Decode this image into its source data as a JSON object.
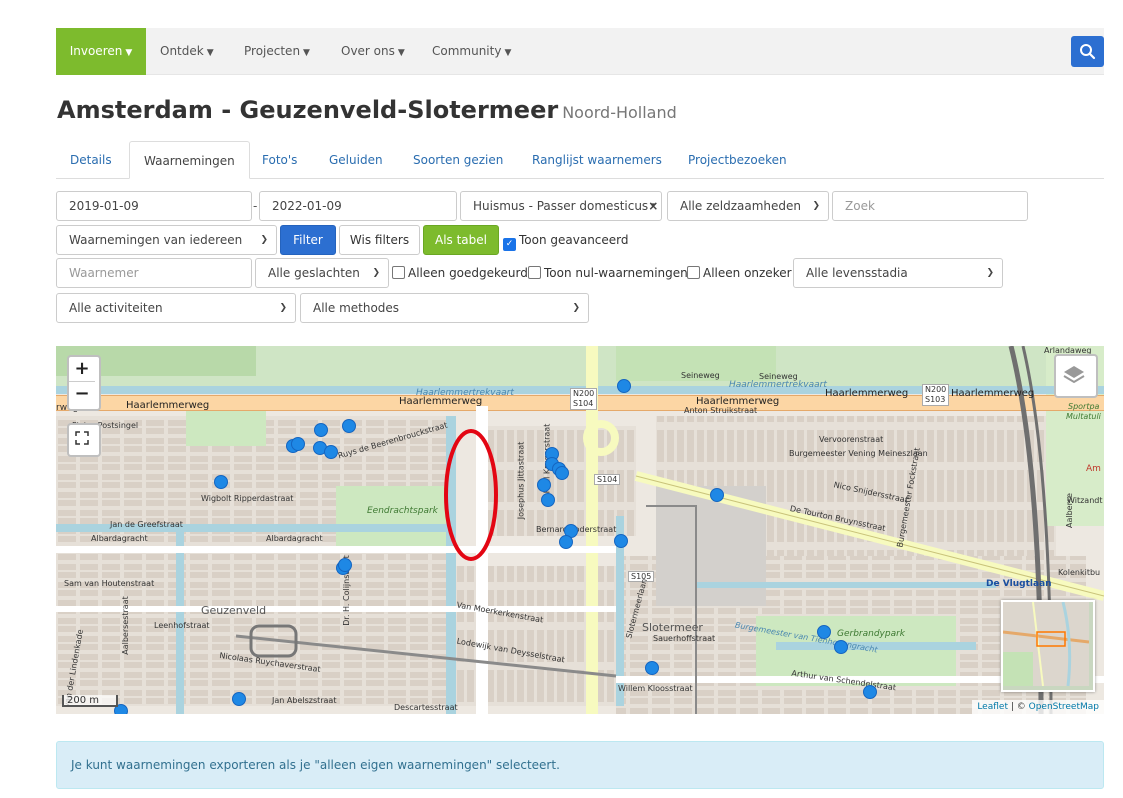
{
  "nav": {
    "items": [
      {
        "label": "Invoeren"
      },
      {
        "label": "Ontdek"
      },
      {
        "label": "Projecten"
      },
      {
        "label": "Over ons"
      },
      {
        "label": "Community"
      }
    ],
    "search_icon": "search-icon",
    "brand_color": "#7dbb2d",
    "accent_color": "#2c6fd1"
  },
  "title": {
    "main": "Amsterdam - Geuzenveld-Slotermeer",
    "province": "Noord-Holland"
  },
  "tabs": [
    {
      "label": "Details",
      "active": false
    },
    {
      "label": "Waarnemingen",
      "active": true
    },
    {
      "label": "Foto's",
      "active": false
    },
    {
      "label": "Geluiden",
      "active": false
    },
    {
      "label": "Soorten gezien",
      "active": false
    },
    {
      "label": "Ranglijst waarnemers",
      "active": false
    },
    {
      "label": "Projectbezoeken",
      "active": false
    }
  ],
  "filters": {
    "date_from": "2019-01-09",
    "date_separator": "-",
    "date_to": "2022-01-09",
    "species": "Huismus - Passer domesticus",
    "species_clear": "×",
    "rarity": "Alle zeldzaamheden",
    "search_placeholder": "Zoek",
    "observer_scope": "Waarnemingen van iedereen",
    "filter_button": "Filter",
    "clear_button": "Wis filters",
    "table_button": "Als tabel",
    "advanced_label": "Toon geavanceerd",
    "advanced_checked": true,
    "observer_placeholder": "Waarnemer",
    "sex": "Alle geslachten",
    "approved_label": "Alleen goedgekeurd",
    "zero_label": "Toon nul-waarnemingen",
    "uncertain_label": "Alleen onzeker",
    "life_stage": "Alle levensstadia",
    "activity": "Alle activiteiten",
    "method": "Alle methodes"
  },
  "map": {
    "zoom_in": "+",
    "zoom_out": "−",
    "scale_label": "200 m",
    "attribution_leaflet": "Leaflet",
    "attribution_sep": " | © ",
    "attribution_osm": "OpenStreetMap",
    "marker_color": "#1e88e5",
    "highlight_color": "#e30613",
    "street_labels": {
      "haarlemmerweg_west": "Haarlemmerweg",
      "haarlemmerweg_mid": "Haarlemmerweg",
      "haarlemmerweg_east": "Haarlemmerweg",
      "haarlemmerweg_east2": "Haarlemmerweg",
      "haarlemmerweg_far": "Haarlemmerweg",
      "haarlemmerweg_wrap": "rweg",
      "vaart1": "Haarlemmertrekvaart",
      "vaart2": "Haarlemmertrekvaart",
      "seineweg": "Seineweg",
      "arlandaweg": "Arlandaweg",
      "n200_a": "N200",
      "s104_a": "S104",
      "n200_b": "N200",
      "s103": "S103",
      "s104_b": "S104",
      "s105": "S105",
      "postsingel": "Pieter Postsingel",
      "ruys": "Ruys de Beerenbrouckstraat",
      "anton": "Anton Struikstraat",
      "vervoorenstraat": "Vervoorenstraat",
      "vening": "Burgemeester Vening Meineszlaan",
      "wigbolt": "Wigbolt Ripperdastraat",
      "greefstraat": "Jan de Greefstraat",
      "albardagracht1": "Albardagracht",
      "albardagracht2": "Albardagracht",
      "eendrachtspark": "Eendrachtspark",
      "bernard": "Bernard Loderstraat",
      "nico": "Nico Snijdersstraat",
      "tourton": "De Tourton Bruynsstraat",
      "vlugtlaan": "De Vlugtlaan",
      "kolenkit": "Kolenkitbu",
      "houtenstraat": "Sam van Houtenstraat",
      "moerkerken": "Van Moerkerkenstraat",
      "slotermeerlaan": "Slotermeerlaan",
      "slotermeer": "Slotermeer",
      "sauerhoff": "Sauerhoffstraat",
      "geuzenveld": "Geuzenveld",
      "leenhof": "Leenhofstraat",
      "deysselstraat": "Lodewijk van Deysselstraat",
      "nicolaas": "Nicolaas Ruychaverstraat",
      "abelszstraat": "Jan Abelszstraat",
      "descartes": "Descartesstraat",
      "kloosstraat": "Willem Kloosstraat",
      "schendel": "Arthur van Schendelstraat",
      "gerbrandypark": "Gerbrandypark",
      "tienhoven": "Burgemeester van Tienhovengracht",
      "sportpark": "Sportpa",
      "multatuli": "Multatuli",
      "witzand": "Witzandt",
      "am": "Am",
      "colijn": "Dr. H. Colijnstraat",
      "aalbersestraat": "Aalbersestraat",
      "lindenkade": "van der Lindenkade",
      "paulkruger": "Paul Krugerstraat",
      "josephus": "Josephus Jittastraat",
      "fockstraat": "Burgemeester Fockstraat",
      "aalbersstraat2": "Aalberse"
    }
  },
  "info": {
    "message": "Je kunt waarnemingen exporteren als je \"alleen eigen waarnemingen\" selecteert."
  }
}
